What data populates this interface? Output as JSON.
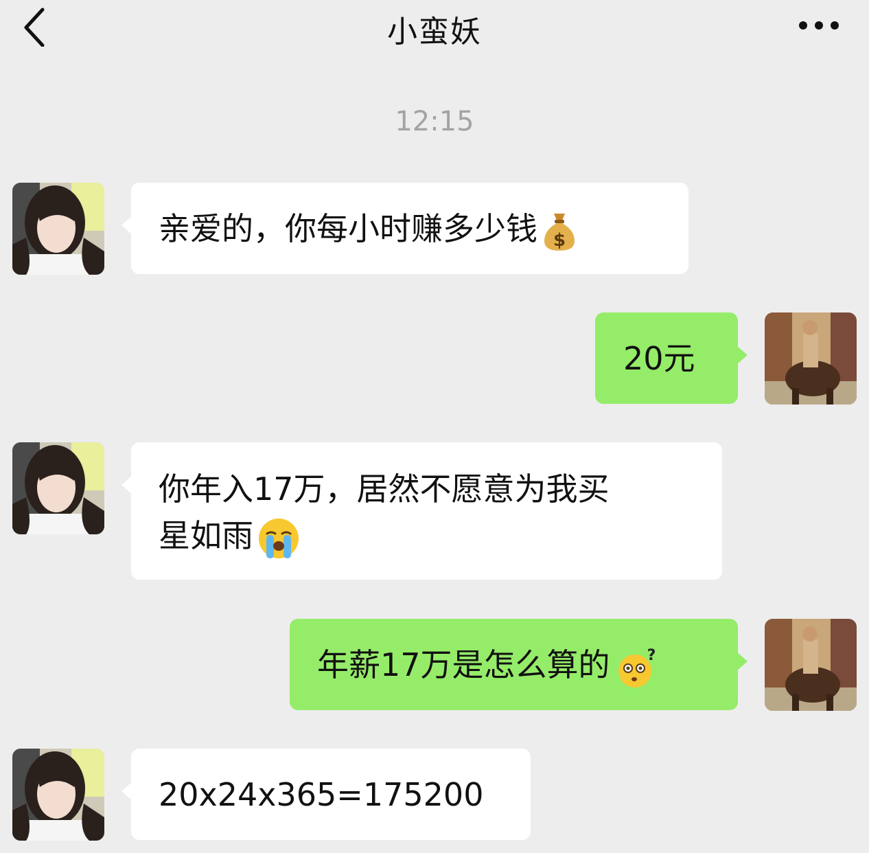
{
  "header": {
    "title": "小蛮妖",
    "back_icon": "chevron-left-icon",
    "more_icon": "more-dots-icon"
  },
  "timestamp": "12:15",
  "messages": [
    {
      "sender": "contact",
      "text": "亲爱的，你每小时赚多少钱",
      "emoji": "money-bag-icon"
    },
    {
      "sender": "me",
      "text": "20元"
    },
    {
      "sender": "contact",
      "line1": "你年入17万，居然不愿意为我买",
      "line2": "星如雨",
      "emoji": "crying-face-icon"
    },
    {
      "sender": "me",
      "text": "年薪17万是怎么算的",
      "emoji": "confused-face-icon"
    },
    {
      "sender": "contact",
      "text": "20x24x365=175200"
    }
  ],
  "colors": {
    "background": "#ededed",
    "incoming_bubble": "#ffffff",
    "outgoing_bubble": "#95ec69",
    "timestamp": "#a3a3a3"
  }
}
